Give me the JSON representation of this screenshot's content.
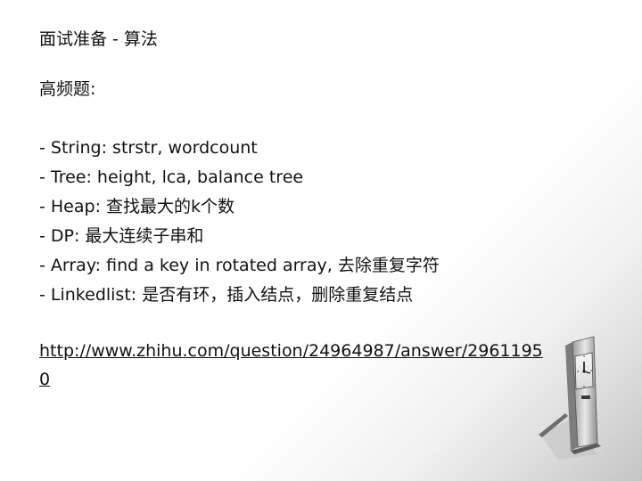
{
  "slide": {
    "title": "面试准备 - 算法",
    "heading": "高频题:",
    "bullets": [
      "- String: strstr, wordcount",
      "- Tree: height, lca, balance tree",
      "- Heap: 查找最大的k个数",
      "- DP: 最大连续子串和",
      "- Array: find a key in rotated array, 去除重复字符",
      "- Linkedlist: 是否有环，插入结点，删除重复结点"
    ],
    "link": "http://www.zhihu.com/question/24964987/answer/29611950"
  },
  "decoration": {
    "icon": "standing-clock-icon"
  }
}
